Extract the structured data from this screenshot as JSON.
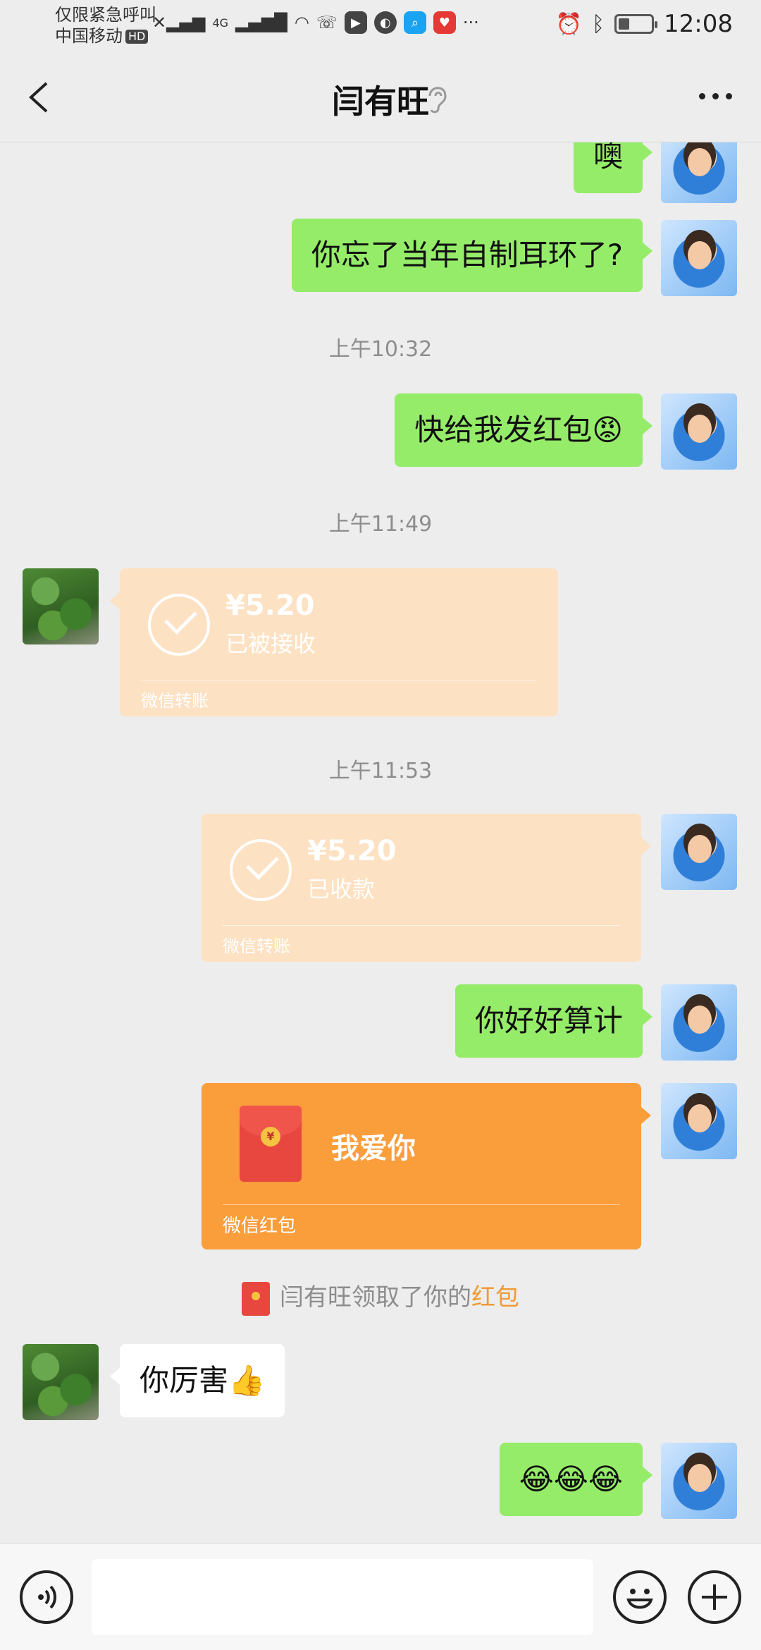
{
  "status_bar": {
    "carrier_line1": "仅限紧急呼叫",
    "carrier_line2": "中国移动",
    "carrier_badge": "HD",
    "network": "4G",
    "more": "···",
    "time": "12:08",
    "battery_level": 0.35
  },
  "nav": {
    "title": "闫有旺"
  },
  "messages": {
    "m1": "噢",
    "m2": "你忘了当年自制耳环了?",
    "time1": "上午10:32",
    "m3": "快给我发红包😡",
    "time2": "上午11:49",
    "transfer1": {
      "amount": "¥5.20",
      "status": "已被接收",
      "footer": "微信转账"
    },
    "time3": "上午11:53",
    "transfer2": {
      "amount": "¥5.20",
      "status": "已收款",
      "footer": "微信转账"
    },
    "m4": "你好好算计",
    "red_packet": {
      "title": "我爱你",
      "footer": "微信红包",
      "coin": "¥"
    },
    "system_text": "闫有旺领取了你的",
    "system_link": "红包",
    "m5": "你厉害👍",
    "m6": "😂😂😂"
  },
  "input": {
    "placeholder": ""
  },
  "colors": {
    "chat_bg": "#ededed",
    "self_bubble": "#95ec69",
    "transfer_bg": "#fde1c3",
    "red_packet_bg": "#fa9d3b",
    "link": "#f09a37"
  }
}
